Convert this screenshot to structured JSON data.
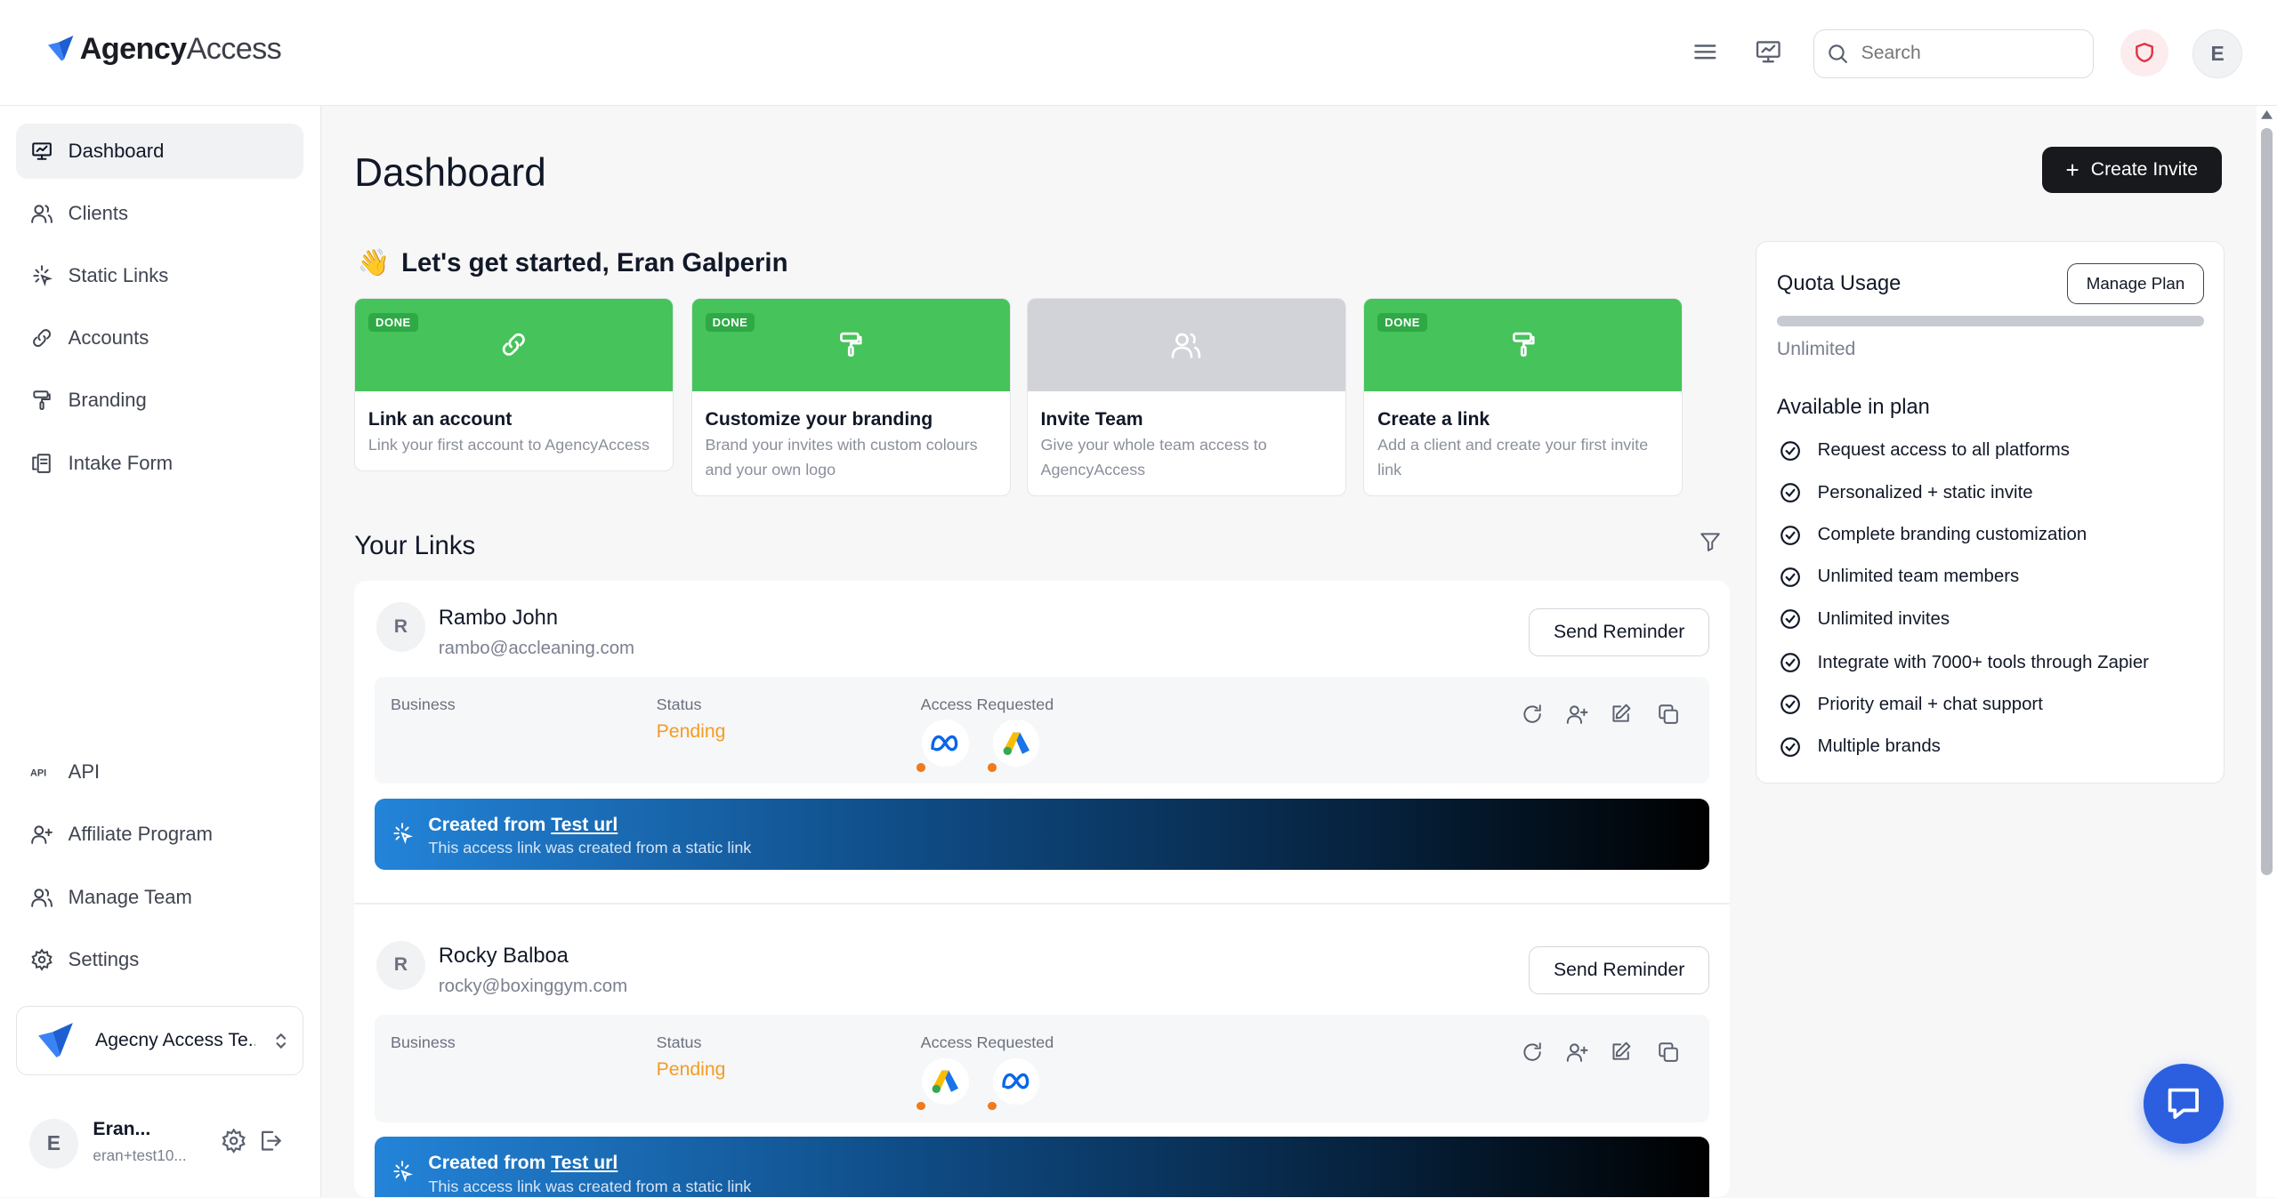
{
  "brand": {
    "name_bold": "Agency",
    "name_light": "Access"
  },
  "header": {
    "search_placeholder": "Search",
    "avatar_initial": "E"
  },
  "sidebar": {
    "items": [
      {
        "label": "Dashboard",
        "icon": "monitor-icon"
      },
      {
        "label": "Clients",
        "icon": "users-icon"
      },
      {
        "label": "Static Links",
        "icon": "sparkle-icon"
      },
      {
        "label": "Accounts",
        "icon": "link-icon"
      },
      {
        "label": "Branding",
        "icon": "paint-roller-icon"
      },
      {
        "label": "Intake Form",
        "icon": "form-icon"
      }
    ],
    "bottom_items": [
      {
        "label": "API",
        "icon": "api-icon"
      },
      {
        "label": "Affiliate Program",
        "icon": "user-plus-icon"
      },
      {
        "label": "Manage Team",
        "icon": "users-icon"
      },
      {
        "label": "Settings",
        "icon": "gear-icon"
      }
    ],
    "brand_switch": {
      "name": "Agecny Access Te..."
    },
    "user": {
      "initial": "E",
      "name": "Eran...",
      "email": "eran+test10..."
    }
  },
  "main": {
    "title": "Dashboard",
    "create_invite_label": "Create Invite",
    "welcome": "Let's get started, Eran Galperin",
    "welcome_emoji": "👋",
    "steps": [
      {
        "badge": "DONE",
        "title": "Link an account",
        "desc": "Link your first account to AgencyAccess",
        "done": true
      },
      {
        "badge": "DONE",
        "title": "Customize your branding",
        "desc": "Brand your invites with custom colours and your own logo",
        "done": true
      },
      {
        "badge": "",
        "title": "Invite Team",
        "desc": "Give your whole team access to AgencyAccess",
        "done": false
      },
      {
        "badge": "DONE",
        "title": "Create a link",
        "desc": "Add a client and create your first invite link",
        "done": true
      }
    ],
    "your_links_title": "Your Links",
    "links": [
      {
        "initial": "R",
        "name": "Rambo John",
        "email": "rambo@accleaning.com",
        "reminder_label": "Send Reminder",
        "business_label": "Business",
        "status_label": "Status",
        "status": "Pending",
        "access_label": "Access Requested",
        "platforms": [
          "meta-icon",
          "google-ads-icon"
        ],
        "banner_prefix": "Created from ",
        "banner_link": "Test url",
        "banner_sub": "This access link was created from a static link"
      },
      {
        "initial": "R",
        "name": "Rocky Balboa",
        "email": "rocky@boxinggym.com",
        "reminder_label": "Send Reminder",
        "business_label": "Business",
        "status_label": "Status",
        "status": "Pending",
        "access_label": "Access Requested",
        "platforms": [
          "google-ads-icon",
          "meta-icon"
        ],
        "banner_prefix": "Created from ",
        "banner_link": "Test url",
        "banner_sub": "This access link was created from a static link"
      }
    ]
  },
  "quota": {
    "title": "Quota Usage",
    "manage_label": "Manage Plan",
    "usage_value": "Unlimited",
    "plan_title": "Available in plan",
    "features": [
      "Request access to all platforms",
      "Personalized + static invite",
      "Complete branding customization",
      "Unlimited team members",
      "Unlimited invites",
      "Integrate with 7000+ tools through Zapier",
      "Priority email + chat support",
      "Multiple brands"
    ]
  },
  "colors": {
    "done_green": "#46c35b",
    "pending_orange": "#f39c24",
    "chat_blue": "#2b5fe0"
  }
}
